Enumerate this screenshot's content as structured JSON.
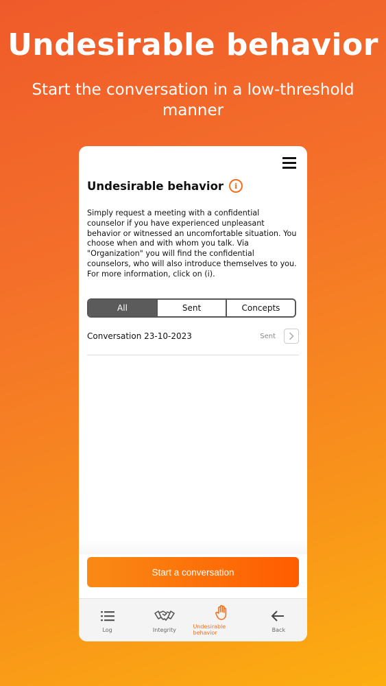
{
  "promo": {
    "title": "Undesirable behavior",
    "subtitle": "Start the conversation in a low-threshold manner"
  },
  "screen": {
    "title": "Undesirable behavior",
    "info_icon": "i",
    "description": "Simply request a meeting with a confidential counselor if you have experienced unpleasant behavior or witnessed an uncomfortable situation. You choose when and with whom you talk. Via \"Organization\" you will find the confidential counselors, who will also introduce themselves to you.\nFor more information, click on (i).",
    "filters": [
      "All",
      "Sent",
      "Concepts"
    ],
    "active_filter": "All",
    "conversations": [
      {
        "title": "Conversation 23-10-2023",
        "status": "Sent"
      }
    ],
    "start_button": "Start a conversation"
  },
  "tabbar": {
    "items": [
      {
        "label": "Log",
        "icon": "list-icon"
      },
      {
        "label": "Integrity",
        "icon": "handshake-icon"
      },
      {
        "label": "Undesirable behavior",
        "icon": "hand-icon"
      },
      {
        "label": "Back",
        "icon": "back-arrow-icon"
      }
    ],
    "active": "Undesirable behavior"
  },
  "colors": {
    "accent": "#f36f1e",
    "segment_active": "#5b5b5b"
  }
}
